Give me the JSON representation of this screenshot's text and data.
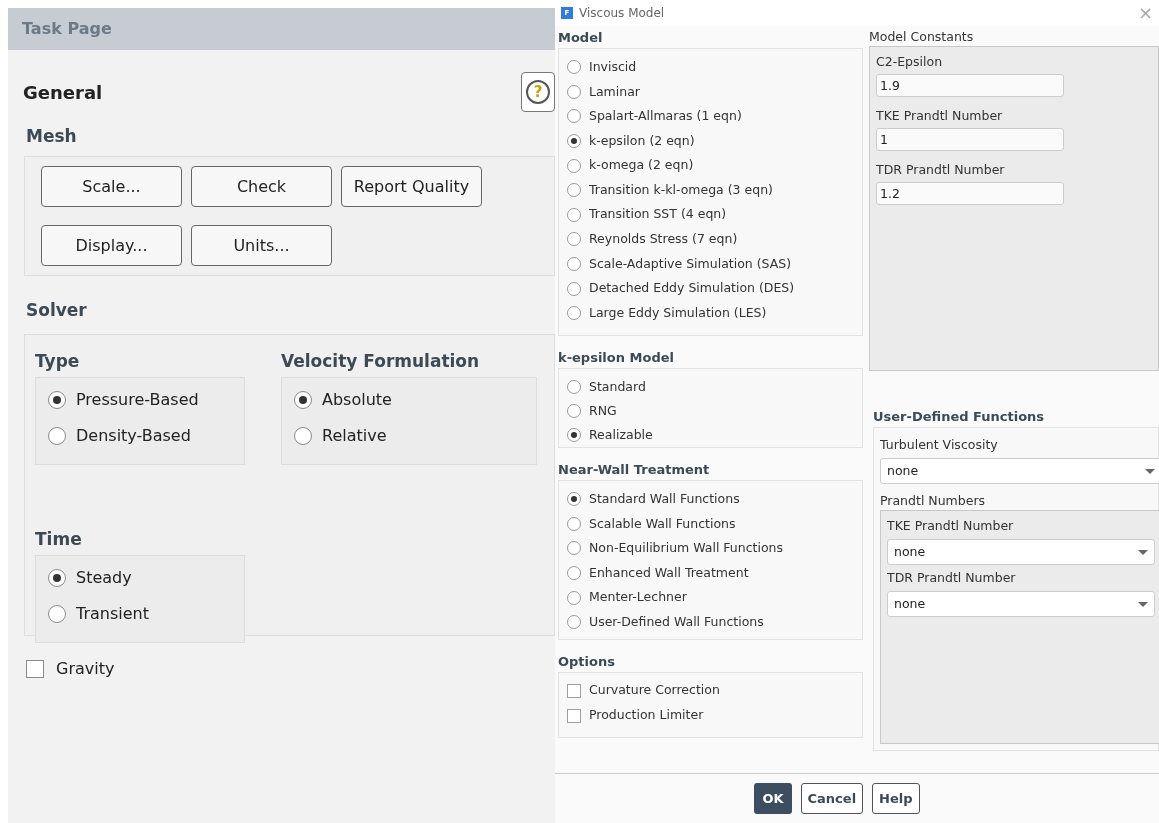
{
  "task_page": {
    "title": "Task Page",
    "heading": "General",
    "help_button": "?",
    "mesh": {
      "label": "Mesh",
      "buttons": [
        "Scale...",
        "Check",
        "Report Quality",
        "Display...",
        "Units..."
      ]
    },
    "solver": {
      "label": "Solver",
      "type": {
        "label": "Type",
        "options": [
          {
            "label": "Pressure-Based",
            "selected": true
          },
          {
            "label": "Density-Based",
            "selected": false
          }
        ]
      },
      "velocity_formulation": {
        "label": "Velocity Formulation",
        "options": [
          {
            "label": "Absolute",
            "selected": true
          },
          {
            "label": "Relative",
            "selected": false
          }
        ]
      },
      "time": {
        "label": "Time",
        "options": [
          {
            "label": "Steady",
            "selected": true
          },
          {
            "label": "Transient",
            "selected": false
          }
        ]
      }
    },
    "gravity": {
      "label": "Gravity",
      "checked": false
    }
  },
  "dialog": {
    "title": "Viscous Model",
    "app_icon": "F",
    "close": "×",
    "model": {
      "label": "Model",
      "options": [
        {
          "label": "Inviscid",
          "selected": false
        },
        {
          "label": "Laminar",
          "selected": false
        },
        {
          "label": "Spalart-Allmaras (1 eqn)",
          "selected": false
        },
        {
          "label": "k-epsilon (2 eqn)",
          "selected": true
        },
        {
          "label": "k-omega (2 eqn)",
          "selected": false
        },
        {
          "label": "Transition k-kl-omega (3 eqn)",
          "selected": false
        },
        {
          "label": "Transition SST (4 eqn)",
          "selected": false
        },
        {
          "label": "Reynolds Stress (7 eqn)",
          "selected": false
        },
        {
          "label": "Scale-Adaptive Simulation (SAS)",
          "selected": false
        },
        {
          "label": "Detached Eddy Simulation (DES)",
          "selected": false
        },
        {
          "label": "Large Eddy Simulation (LES)",
          "selected": false
        }
      ]
    },
    "k_epsilon_model": {
      "label": "k-epsilon Model",
      "options": [
        {
          "label": "Standard",
          "selected": false
        },
        {
          "label": "RNG",
          "selected": false
        },
        {
          "label": "Realizable",
          "selected": true
        }
      ]
    },
    "near_wall_treatment": {
      "label": "Near-Wall Treatment",
      "options": [
        {
          "label": "Standard Wall Functions",
          "selected": true
        },
        {
          "label": "Scalable Wall Functions",
          "selected": false
        },
        {
          "label": "Non-Equilibrium Wall Functions",
          "selected": false
        },
        {
          "label": "Enhanced Wall Treatment",
          "selected": false
        },
        {
          "label": "Menter-Lechner",
          "selected": false
        },
        {
          "label": "User-Defined Wall Functions",
          "selected": false
        }
      ]
    },
    "options": {
      "label": "Options",
      "items": [
        {
          "label": "Curvature Correction",
          "checked": false
        },
        {
          "label": "Production Limiter",
          "checked": false
        }
      ]
    },
    "model_constants": {
      "label": "Model Constants",
      "fields": [
        {
          "label": "C2-Epsilon",
          "value": "1.9"
        },
        {
          "label": "TKE Prandtl Number",
          "value": "1"
        },
        {
          "label": "TDR Prandtl Number",
          "value": "1.2"
        }
      ]
    },
    "user_defined_functions": {
      "label": "User-Defined Functions",
      "turbulent_viscosity": {
        "label": "Turbulent Viscosity",
        "value": "none"
      },
      "prandtl_numbers": {
        "label": "Prandtl Numbers",
        "fields": [
          {
            "label": "TKE Prandtl Number",
            "value": "none"
          },
          {
            "label": "TDR Prandtl Number",
            "value": "none"
          }
        ]
      }
    },
    "buttons": [
      "OK",
      "Cancel",
      "Help"
    ]
  }
}
